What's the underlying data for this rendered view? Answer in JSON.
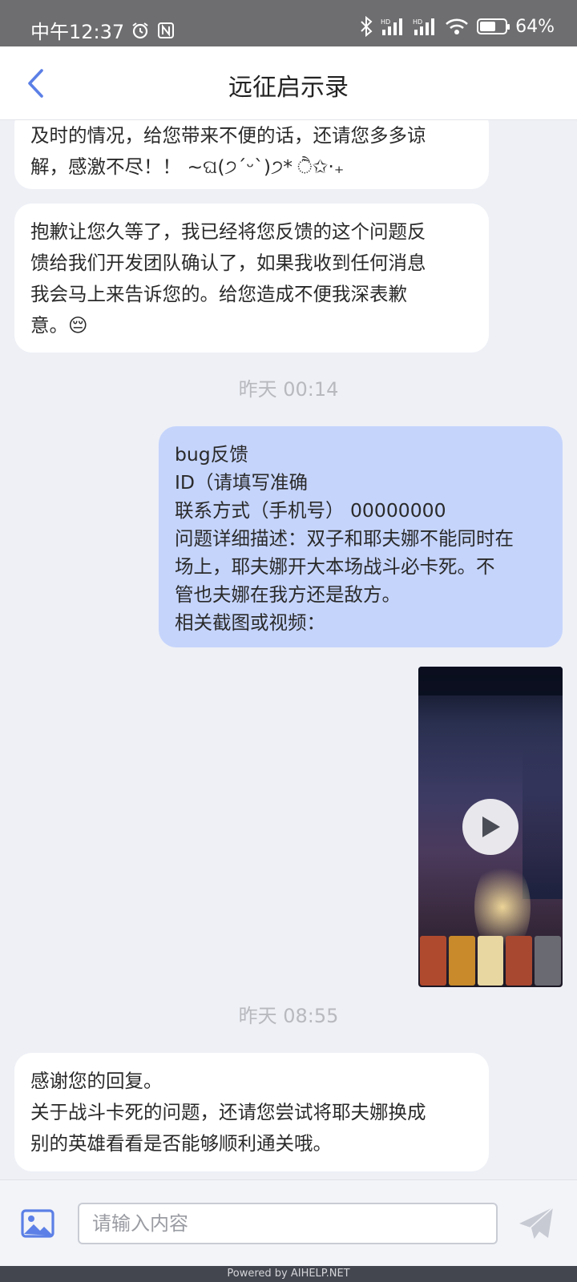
{
  "status_bar": {
    "time": "中午12:37",
    "battery_percent": "64%",
    "battery_level": 0.64
  },
  "header": {
    "title": "远征启示录"
  },
  "messages": [
    {
      "role": "agent",
      "text": "及时的情况，给您带来不便的话，还请您多多谅\n解，感激不尽！！ ~ଘ(੭ˊᵕˋ)੭* ੈ✩‧₊"
    },
    {
      "role": "agent",
      "text": "抱歉让您久等了，我已经将您反馈的这个问题反\n馈给我们开发团队确认了，如果我收到任何消息\n我会马上来告诉您的。给您造成不便我深表歉\n意。😔"
    },
    {
      "role": "time",
      "text": "昨天 00:14"
    },
    {
      "role": "user",
      "text": "bug反馈\nID（请填写准确\n联系方式（手机号）       00000000\n问题详细描述：双子和耶夫娜不能同时在\n场上，耶夫娜开大本场战斗必卡死。不\n管也夫娜在我方还是敌方。\n相关截图或视频："
    },
    {
      "role": "time",
      "text": "昨天 08:55"
    },
    {
      "role": "agent",
      "text": "感谢您的回复。\n关于战斗卡死的问题，还请您尝试将耶夫娜换成\n别的英雄看看是否能够顺利通关哦。"
    }
  ],
  "input": {
    "placeholder": "请输入内容"
  },
  "footer": {
    "powered_by": "Powered by AIHELP.NET"
  },
  "colors": {
    "accent": "#5b7fe6",
    "user_bubble": "#c5d4fb",
    "agent_bubble": "#ffffff",
    "background": "#eef0f6"
  },
  "icons": {
    "back": "chevron-left-icon",
    "image": "image-icon",
    "send": "send-icon",
    "play": "play-icon"
  }
}
